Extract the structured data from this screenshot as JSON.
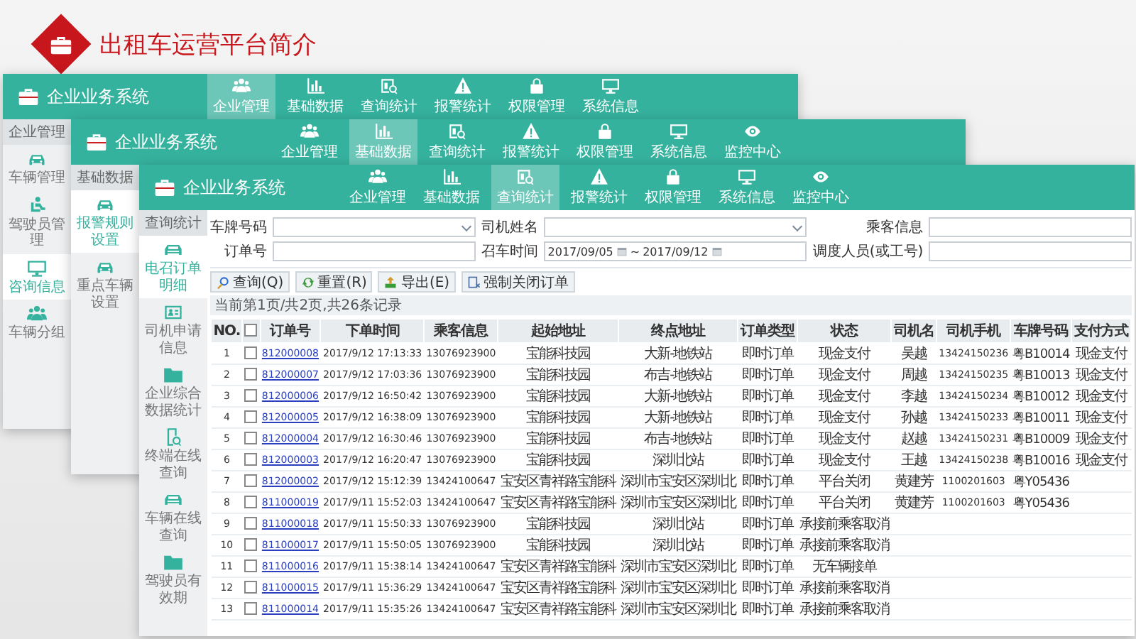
{
  "slide_title": "出租车运营平台简介",
  "windows": [
    {
      "title": "企业业务系统",
      "nav": [
        {
          "label": "企业管理",
          "selected": true
        },
        {
          "label": "基础数据",
          "selected": false
        },
        {
          "label": "查询统计",
          "selected": false
        },
        {
          "label": "报警统计",
          "selected": false
        },
        {
          "label": "权限管理",
          "selected": false
        },
        {
          "label": "系统信息",
          "selected": false
        }
      ],
      "sidebar": {
        "heading": "企业管理",
        "items": [
          {
            "label": "车辆管理",
            "selected": false
          },
          {
            "label": "驾驶员管理",
            "selected": false
          },
          {
            "label": "咨询信息",
            "selected": true
          },
          {
            "label": "车辆分组",
            "selected": false
          }
        ]
      }
    },
    {
      "title": "企业业务系统",
      "nav": [
        {
          "label": "企业管理",
          "selected": false
        },
        {
          "label": "基础数据",
          "selected": true
        },
        {
          "label": "查询统计",
          "selected": false
        },
        {
          "label": "报警统计",
          "selected": false
        },
        {
          "label": "权限管理",
          "selected": false
        },
        {
          "label": "系统信息",
          "selected": false
        },
        {
          "label": "监控中心",
          "selected": false
        }
      ],
      "sidebar": {
        "heading": "基础数据",
        "items": [
          {
            "label": "报警规则设置",
            "selected": true
          },
          {
            "label": "重点车辆设置",
            "selected": false
          }
        ]
      }
    },
    {
      "title": "企业业务系统",
      "nav": [
        {
          "label": "企业管理",
          "selected": false
        },
        {
          "label": "基础数据",
          "selected": false
        },
        {
          "label": "查询统计",
          "selected": true
        },
        {
          "label": "报警统计",
          "selected": false
        },
        {
          "label": "权限管理",
          "selected": false
        },
        {
          "label": "系统信息",
          "selected": false
        },
        {
          "label": "监控中心",
          "selected": false
        }
      ],
      "sidebar": {
        "heading": "查询统计",
        "items": [
          {
            "label": "电召订单明细",
            "selected": true
          },
          {
            "label": "司机申请信息",
            "selected": false
          },
          {
            "label": "企业综合数据统计",
            "selected": false
          },
          {
            "label": "终端在线查询",
            "selected": false
          },
          {
            "label": "车辆在线查询",
            "selected": false
          },
          {
            "label": "驾驶员有效期",
            "selected": false
          }
        ]
      },
      "content": {
        "filters": [
          {
            "label": "车牌号码",
            "kind": "select"
          },
          {
            "label": "司机姓名",
            "kind": "select"
          },
          {
            "label": "乘客信息",
            "kind": "text"
          },
          {
            "label": "订单号",
            "kind": "text"
          },
          {
            "label": "召车时间",
            "kind": "daterange",
            "from": "2017/09/05",
            "separator": "~",
            "to": "2017/09/12"
          },
          {
            "label": "调度人员(或工号)",
            "kind": "text"
          }
        ],
        "toolbar": [
          "查询(Q)",
          "重置(R)",
          "导出(E)",
          "强制关闭订单"
        ],
        "page_info": "当前第1页/共2页,共26条记录",
        "table": {
          "columns": [
            "NO.",
            "订单号",
            "下单时间",
            "乘客信息",
            "起始地址",
            "终点地址",
            "订单类型",
            "状态",
            "司机名",
            "司机手机",
            "车牌号码",
            "支付方式"
          ],
          "all_checked": false,
          "rows": [
            {
              "checked": false,
              "no": "1",
              "order": "812000008",
              "time": "2017/9/12 17:13:33",
              "phone": "13076923900",
              "from": "宝能科技园",
              "to": "大新-地铁站",
              "type": "即时订单",
              "status": "现金支付",
              "driver": "吴越",
              "driver_phone": "13424150236",
              "plate": "粤B10014",
              "payment": "现金支付"
            },
            {
              "checked": false,
              "no": "2",
              "order": "812000007",
              "time": "2017/9/12 17:03:36",
              "phone": "13076923900",
              "from": "宝能科技园",
              "to": "布吉-地铁站",
              "type": "即时订单",
              "status": "现金支付",
              "driver": "周越",
              "driver_phone": "13424150235",
              "plate": "粤B10013",
              "payment": "现金支付"
            },
            {
              "checked": false,
              "no": "3",
              "order": "812000006",
              "time": "2017/9/12 16:50:42",
              "phone": "13076923900",
              "from": "宝能科技园",
              "to": "大新-地铁站",
              "type": "即时订单",
              "status": "现金支付",
              "driver": "李越",
              "driver_phone": "13424150234",
              "plate": "粤B10012",
              "payment": "现金支付"
            },
            {
              "checked": false,
              "no": "4",
              "order": "812000005",
              "time": "2017/9/12 16:38:09",
              "phone": "13076923900",
              "from": "宝能科技园",
              "to": "大新-地铁站",
              "type": "即时订单",
              "status": "现金支付",
              "driver": "孙越",
              "driver_phone": "13424150233",
              "plate": "粤B10011",
              "payment": "现金支付"
            },
            {
              "checked": false,
              "no": "5",
              "order": "812000004",
              "time": "2017/9/12 16:30:46",
              "phone": "13076923900",
              "from": "宝能科技园",
              "to": "布吉-地铁站",
              "type": "即时订单",
              "status": "现金支付",
              "driver": "赵越",
              "driver_phone": "13424150231",
              "plate": "粤B10009",
              "payment": "现金支付"
            },
            {
              "checked": false,
              "no": "6",
              "order": "812000003",
              "time": "2017/9/12 16:20:47",
              "phone": "13076923900",
              "from": "宝能科技园",
              "to": "深圳北站",
              "type": "即时订单",
              "status": "现金支付",
              "driver": "王越",
              "driver_phone": "13424150238",
              "plate": "粤B10016",
              "payment": "现金支付"
            },
            {
              "checked": false,
              "no": "7",
              "order": "812000002",
              "time": "2017/9/12 15:12:39",
              "phone": "13424100647",
              "from": "宝安区青祥路宝能科",
              "to": "深圳市宝安区深圳北",
              "type": "即时订单",
              "status": "平台关闭",
              "driver": "黄建芳",
              "driver_phone": "1100201603",
              "plate": "粤Y05436"
            },
            {
              "checked": false,
              "no": "8",
              "order": "811000019",
              "time": "2017/9/11 15:52:03",
              "phone": "13424100647",
              "from": "宝安区青祥路宝能科",
              "to": "深圳市宝安区深圳北",
              "type": "即时订单",
              "status": "平台关闭",
              "driver": "黄建芳",
              "driver_phone": "1100201603",
              "plate": "粤Y05436"
            },
            {
              "checked": false,
              "no": "9",
              "order": "811000018",
              "time": "2017/9/11 15:50:33",
              "phone": "13076923900",
              "from": "宝能科技园",
              "to": "深圳北站",
              "type": "即时订单",
              "status": "承接前乘客取消"
            },
            {
              "checked": false,
              "no": "10",
              "order": "811000017",
              "time": "2017/9/11 15:50:05",
              "phone": "13076923900",
              "from": "宝能科技园",
              "to": "深圳北站",
              "type": "即时订单",
              "status": "承接前乘客取消"
            },
            {
              "checked": false,
              "no": "11",
              "order": "811000016",
              "time": "2017/9/11 15:38:14",
              "phone": "13424100647",
              "from": "宝安区青祥路宝能科",
              "to": "深圳市宝安区深圳北",
              "type": "即时订单",
              "status": "无车辆接单"
            },
            {
              "checked": false,
              "no": "12",
              "order": "811000015",
              "time": "2017/9/11 15:36:29",
              "phone": "13424100647",
              "from": "宝安区青祥路宝能科",
              "to": "深圳市宝安区深圳北",
              "type": "即时订单",
              "status": "承接前乘客取消"
            },
            {
              "checked": false,
              "no": "13",
              "order": "811000014",
              "time": "2017/9/11 15:35:26",
              "phone": "13424100647",
              "from": "宝安区青祥路宝能科",
              "to": "深圳市宝安区深圳北",
              "type": "即时订单",
              "status": "承接前乘客取消"
            }
          ]
        }
      }
    }
  ]
}
